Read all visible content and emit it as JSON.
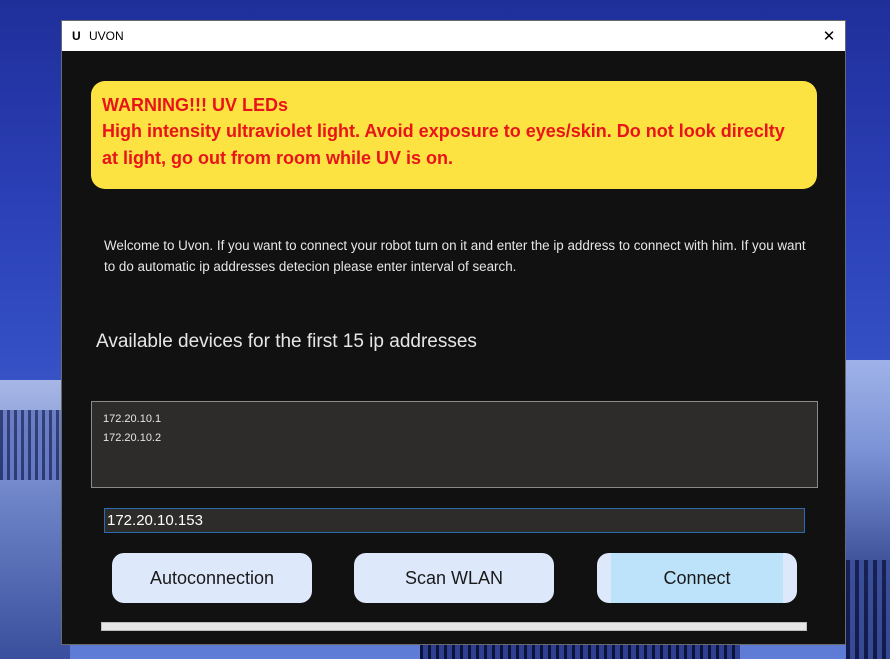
{
  "window": {
    "app_icon": "U",
    "title": "UVON",
    "close_glyph": "✕"
  },
  "warning": {
    "title": "WARNING!!! UV LEDs",
    "text": "High intensity ultraviolet light. Avoid exposure to eyes/skin. Do not look direclty at light, go out from room while UV is on."
  },
  "welcome_text": "Welcome to Uvon. If you want to connect your robot turn on it and enter the ip address to connect with him. If you want to do automatic ip addresses detecion please enter interval of search.",
  "devices": {
    "heading": "Available devices for the first 15 ip addresses",
    "items": [
      "172.20.10.1",
      "172.20.10.2"
    ]
  },
  "ip_input": {
    "value": "172.20.10.153"
  },
  "buttons": {
    "autoconnection": "Autoconnection",
    "scan_wlan": "Scan WLAN",
    "connect": "Connect"
  },
  "progress": {
    "value_percent": 0
  },
  "colors": {
    "warning_bg": "#fde342",
    "warning_text": "#e8141a",
    "window_bg": "#111111",
    "button_bg": "#dde9fb",
    "connect_highlight": "#bde3fb",
    "input_border": "#2a6bb0"
  },
  "icons": {
    "close": "close-icon",
    "app": "app-logo-icon"
  }
}
